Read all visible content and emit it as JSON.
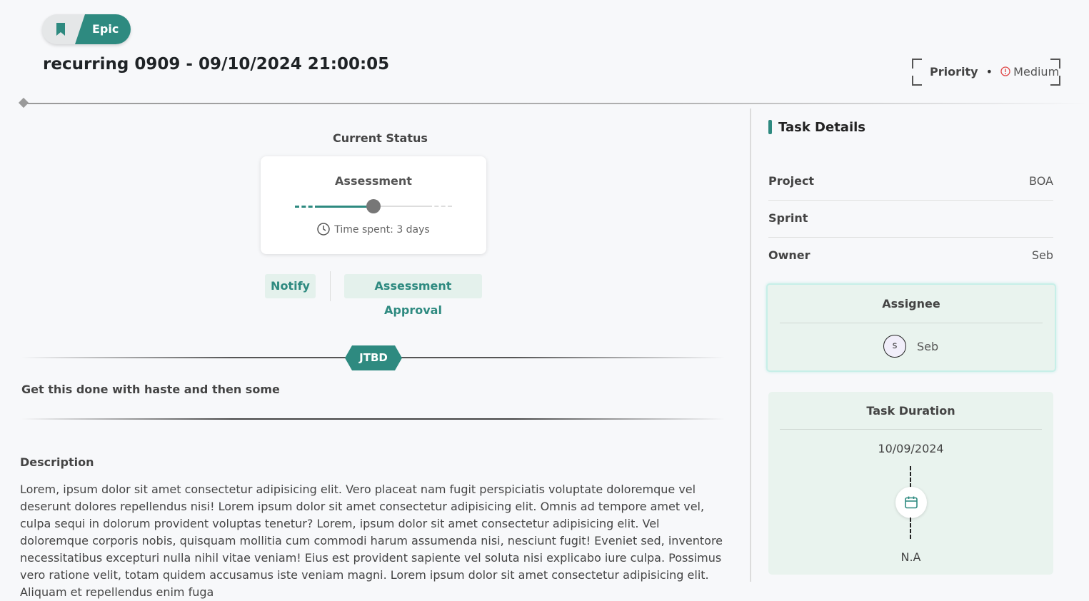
{
  "task": {
    "type_label": "Epic",
    "title": "recurring 0909 - 09/10/2024 21:00:05",
    "priority_label": "Priority",
    "priority_separator": "•",
    "priority_value": "Medium"
  },
  "status": {
    "section_label": "Current Status",
    "current": "Assessment",
    "progress_fraction": 0.5,
    "time_spent": "Time spent: 3 days"
  },
  "actions": {
    "notify_label": "Notify",
    "approval_label": "Assessment Approval"
  },
  "jtbd": {
    "badge": "JTBD",
    "text": "Get this done with haste and then some"
  },
  "description": {
    "title": "Description",
    "body": "Lorem, ipsum dolor sit amet consectetur adipisicing elit. Vero placeat nam fugit perspiciatis voluptate doloremque vel deserunt dolores repellendus nisi! Lorem ipsum dolor sit amet consectetur adipisicing elit. Omnis ad tempore amet vel, culpa sequi in dolorum provident voluptas tenetur? Lorem, ipsum dolor sit amet consectetur adipisicing elit. Vel doloremque corporis nobis, quisquam mollitia cum commodi harum assumenda nisi, nesciunt fugit! Eveniet sed, inventore necessitatibus excepturi nulla nihil vitae veniam! Eius est provident sapiente vel soluta nisi explicabo iure culpa. Possimus vero ratione velit, totam quidem accusamus iste veniam magni. Lorem ipsum dolor sit amet consectetur adipisicing elit. Aliquam et repellendus enim fuga"
  },
  "details": {
    "title": "Task Details",
    "project_label": "Project",
    "project_value": "BOA",
    "sprint_label": "Sprint",
    "sprint_value": "",
    "owner_label": "Owner",
    "owner_value": "Seb"
  },
  "assignee": {
    "title": "Assignee",
    "initial": "s",
    "name": "Seb"
  },
  "duration": {
    "title": "Task Duration",
    "start": "10/09/2024",
    "end": "N.A"
  },
  "icons": {
    "type": "bookmark-icon",
    "priority": "alert-circle-icon",
    "time": "clock-icon",
    "duration": "calendar-icon"
  },
  "colors": {
    "accent": "#2e8a80",
    "accent_light": "#e4f1ec",
    "alert": "#e04848"
  }
}
